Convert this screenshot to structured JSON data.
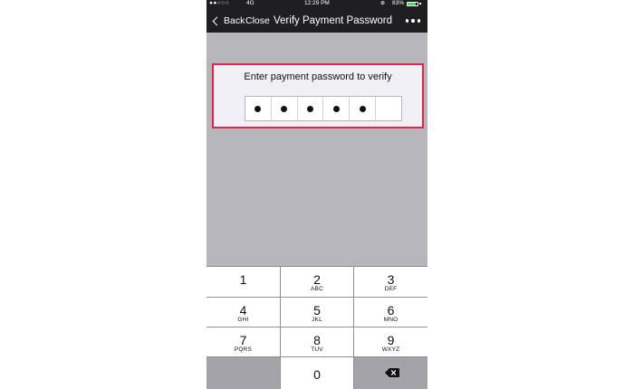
{
  "status_bar": {
    "signal": "●●○○○",
    "network": "4G",
    "time": "12:29 PM",
    "lock_icon": "⊕",
    "battery_text": "83%",
    "battery_level": 0.83
  },
  "nav": {
    "back_label": "Back",
    "close_label": "Close",
    "title": "Verify Payment Password",
    "more_icon": "more-dots-icon"
  },
  "verify": {
    "prompt": "Enter payment password to verify",
    "pin_length": 6,
    "pin_filled": 5
  },
  "keypad": {
    "keys": [
      {
        "digit": "1",
        "letters": ""
      },
      {
        "digit": "2",
        "letters": "ABC"
      },
      {
        "digit": "3",
        "letters": "DEF"
      },
      {
        "digit": "4",
        "letters": "GHI"
      },
      {
        "digit": "5",
        "letters": "JKL"
      },
      {
        "digit": "6",
        "letters": "MNO"
      },
      {
        "digit": "7",
        "letters": "PQRS"
      },
      {
        "digit": "8",
        "letters": "TUV"
      },
      {
        "digit": "9",
        "letters": "WXYZ"
      },
      {
        "digit": "0",
        "letters": ""
      }
    ],
    "backspace_icon": "backspace-icon"
  },
  "colors": {
    "highlight_border": "#e0244e",
    "bar_background": "#1f1f22",
    "battery_fill": "#4cd964"
  }
}
